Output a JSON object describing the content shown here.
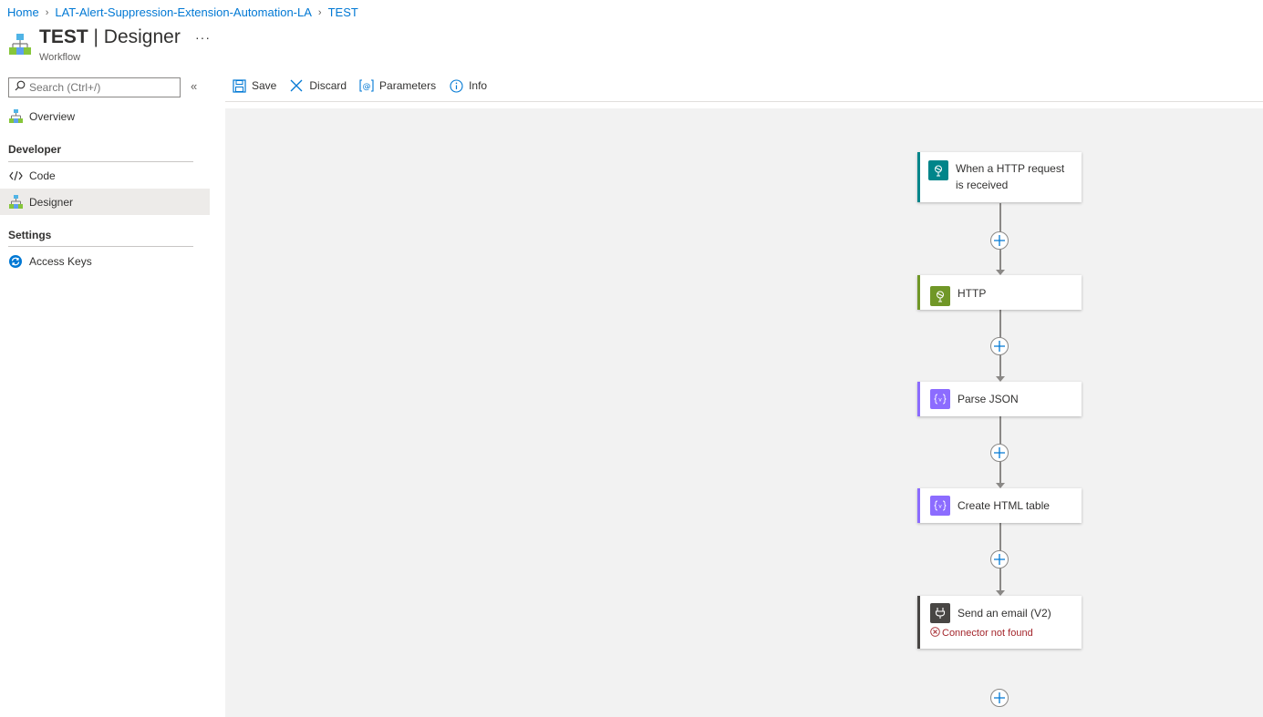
{
  "breadcrumb": {
    "home": "Home",
    "logic_app": "LAT-Alert-Suppression-Extension-Automation-LA",
    "workflow": "TEST"
  },
  "header": {
    "title_resource": "TEST",
    "title_separator": " | ",
    "title_page": "Designer",
    "subtitle": "Workflow",
    "more": "···"
  },
  "sidebar": {
    "search_placeholder": "Search (Ctrl+/)",
    "collapse": "«",
    "overview": "Overview",
    "developer_section": "Developer",
    "code": "Code",
    "designer": "Designer",
    "settings_section": "Settings",
    "access_keys": "Access Keys"
  },
  "toolbar": {
    "save": "Save",
    "discard": "Discard",
    "parameters": "Parameters",
    "info": "Info"
  },
  "workflow": {
    "steps": [
      {
        "label_line1": "When a HTTP request",
        "label_line2": "is received",
        "icon": "http-request-icon",
        "color": "#00858a"
      },
      {
        "label": "HTTP",
        "icon": "http-icon",
        "color": "#709727"
      },
      {
        "label": "Parse JSON",
        "icon": "data-operations-icon",
        "color": "#8c6cff"
      },
      {
        "label": "Create HTML table",
        "icon": "data-operations-icon",
        "color": "#8c6cff"
      },
      {
        "label": "Send an email (V2)",
        "icon": "plug-icon",
        "color": "#484644",
        "error": "Connector not found"
      }
    ]
  },
  "colors": {
    "accent": "#0078d4",
    "error": "#a4262c",
    "canvas": "#f2f2f2"
  }
}
